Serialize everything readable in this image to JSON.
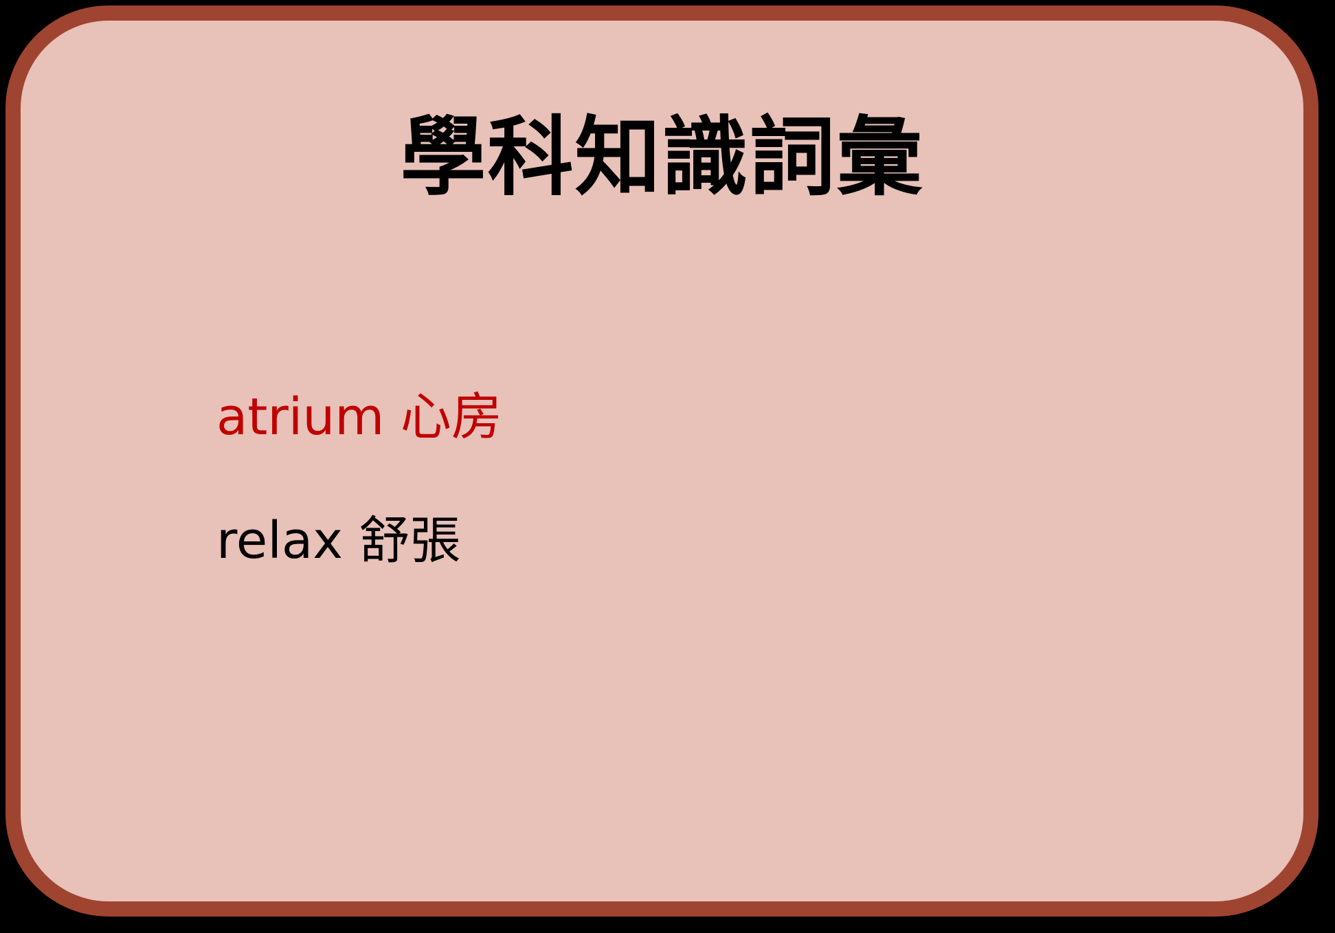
{
  "card": {
    "background_color": "#e8c1b9",
    "border_color": "#9f4431",
    "title": "學科知識詞彙"
  },
  "vocabulary": [
    {
      "term": "atrium",
      "translation": "心房",
      "color": "#c00000"
    },
    {
      "term": "relax",
      "translation": "舒張",
      "color": "#000000"
    }
  ]
}
